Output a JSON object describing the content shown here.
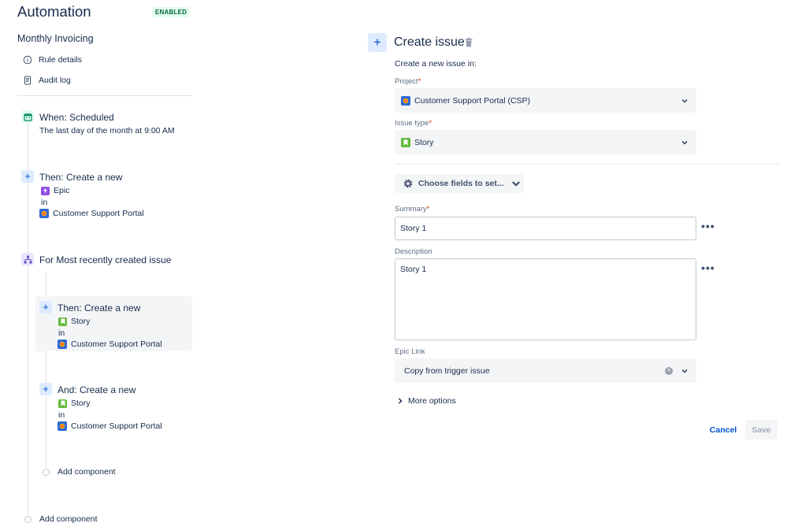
{
  "header": {
    "title": "Automation",
    "status_badge": "ENABLED"
  },
  "rule": {
    "name": "Monthly Invoicing"
  },
  "nav": {
    "rule_details": "Rule details",
    "audit_log": "Audit log"
  },
  "flow": {
    "trigger": {
      "title": "When: Scheduled",
      "detail": "The last day of the month at 9:00 AM"
    },
    "action1": {
      "title": "Then: Create a new",
      "issue_type": "Epic",
      "in": "in",
      "project": "Customer Support Portal"
    },
    "branch": {
      "title": "For Most recently created issue"
    },
    "action2": {
      "title": "Then: Create a new",
      "issue_type": "Story",
      "in": "in",
      "project": "Customer Support Portal"
    },
    "action3": {
      "title": "And: Create a new",
      "issue_type": "Story",
      "in": "in",
      "project": "Customer Support Portal"
    },
    "add_component_inner": "Add component",
    "add_component_outer": "Add component"
  },
  "panel": {
    "title": "Create issue",
    "subtitle": "Create a new issue in:",
    "project_label": "Project",
    "project_value": "Customer Support Portal (CSP)",
    "issue_type_label": "Issue type",
    "issue_type_value": "Story",
    "choose_fields": "Choose fields to set...",
    "summary_label": "Summary",
    "summary_value": "Story 1",
    "description_label": "Description",
    "description_value": "Story 1",
    "epic_link_label": "Epic Link",
    "epic_link_value": "Copy from trigger issue",
    "more_options": "More options",
    "required_mark": "*",
    "cancel": "Cancel",
    "save": "Save"
  },
  "colors": {
    "accent": "#0052cc",
    "enabled_badge_bg": "#e3fcef",
    "enabled_badge_text": "#006644",
    "epic": "#904ee2",
    "story": "#63ba3c",
    "project": "#2f6ad7"
  }
}
